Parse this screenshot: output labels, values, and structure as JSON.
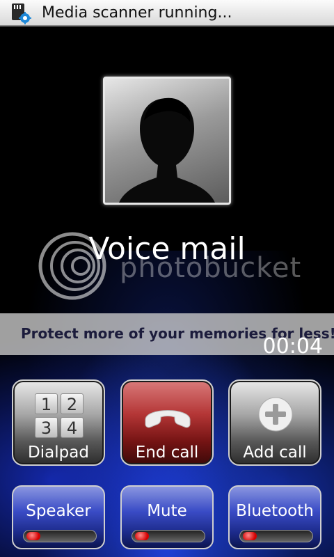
{
  "status_bar": {
    "text": "Media scanner running...",
    "icon": "sd-card-scan-icon"
  },
  "contact": {
    "name": "Voice mail",
    "photo_icon": "contact-silhouette-icon"
  },
  "watermark": {
    "brand": "photobucket",
    "banner": "Protect more of your memories for less!"
  },
  "call": {
    "timer": "00:04"
  },
  "buttons": {
    "dialpad": "Dialpad",
    "end_call": "End call",
    "add_call": "Add call",
    "speaker": "Speaker",
    "mute": "Mute",
    "bluetooth": "Bluetooth"
  },
  "dialpad_keys": [
    "1",
    "2",
    "3",
    "4"
  ],
  "colors": {
    "end_call": "#b43636",
    "toggle_blue": "#3a4cc6",
    "led_off": "#d40000",
    "background_glow": "#2848ff"
  },
  "toggles": {
    "speaker_on": false,
    "mute_on": false,
    "bluetooth_on": false
  }
}
